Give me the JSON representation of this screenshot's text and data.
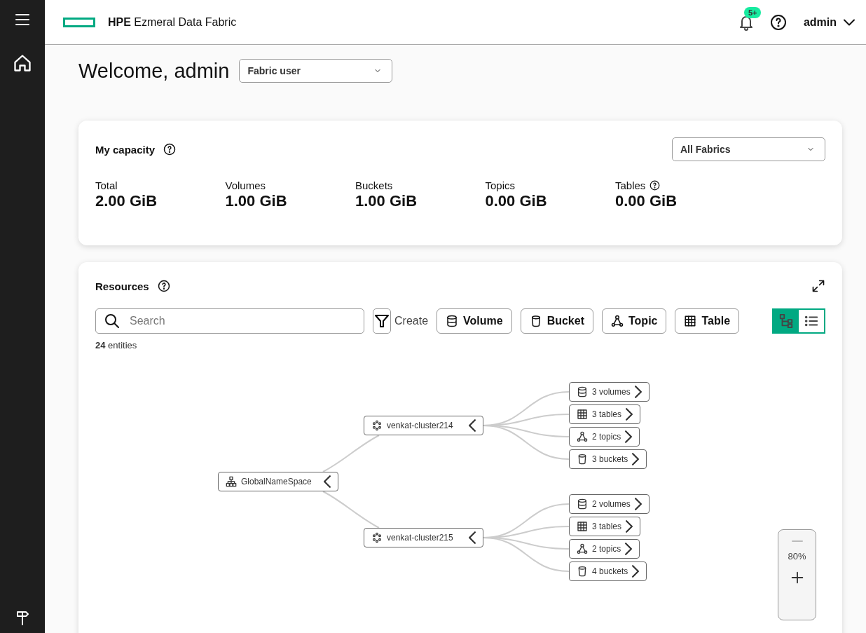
{
  "header": {
    "brand_bold": "HPE",
    "brand_rest": "Ezmeral Data Fabric",
    "notification_badge": "5+",
    "user": "admin"
  },
  "welcome": {
    "title": "Welcome, admin",
    "role_select": "Fabric user"
  },
  "capacity": {
    "title": "My capacity",
    "fabric_select": "All Fabrics",
    "metrics": [
      {
        "label": "Total",
        "value": "2.00 GiB",
        "help": false
      },
      {
        "label": "Volumes",
        "value": "1.00 GiB",
        "help": false
      },
      {
        "label": "Buckets",
        "value": "1.00 GiB",
        "help": false
      },
      {
        "label": "Topics",
        "value": "0.00 GiB",
        "help": false
      },
      {
        "label": "Tables",
        "value": "0.00 GiB",
        "help": true
      }
    ]
  },
  "resources": {
    "title": "Resources",
    "search": {
      "placeholder": "Search"
    },
    "create_label": "Create",
    "create_buttons": [
      {
        "kind": "volume",
        "label": "Volume"
      },
      {
        "kind": "bucket",
        "label": "Bucket"
      },
      {
        "kind": "topic",
        "label": "Topic"
      },
      {
        "kind": "table",
        "label": "Table"
      }
    ],
    "view_toggle": [
      {
        "kind": "tree",
        "selected": true
      },
      {
        "kind": "list",
        "selected": false
      }
    ],
    "entity_count": "**24** entities",
    "tree": {
      "label": "GlobalNameSpace",
      "kind": "namespace",
      "expanded": true,
      "children": [
        {
          "label": "venkat-cluster214",
          "kind": "cluster",
          "expanded": true,
          "children": [
            {
              "label": "3 volumes",
              "kind": "volume",
              "expanded": false
            },
            {
              "label": "3 tables",
              "kind": "table",
              "expanded": false
            },
            {
              "label": "2 topics",
              "kind": "topic",
              "expanded": false
            },
            {
              "label": "3 buckets",
              "kind": "bucket",
              "expanded": false
            }
          ]
        },
        {
          "label": "venkat-cluster215",
          "kind": "cluster",
          "expanded": true,
          "children": [
            {
              "label": "2 volumes",
              "kind": "volume",
              "expanded": false
            },
            {
              "label": "3 tables",
              "kind": "table",
              "expanded": false
            },
            {
              "label": "2 topics",
              "kind": "topic",
              "expanded": false
            },
            {
              "label": "4 buckets",
              "kind": "bucket",
              "expanded": false
            }
          ]
        }
      ]
    },
    "zoom": {
      "level_text": "80%",
      "zoom_out_disabled": true
    }
  }
}
